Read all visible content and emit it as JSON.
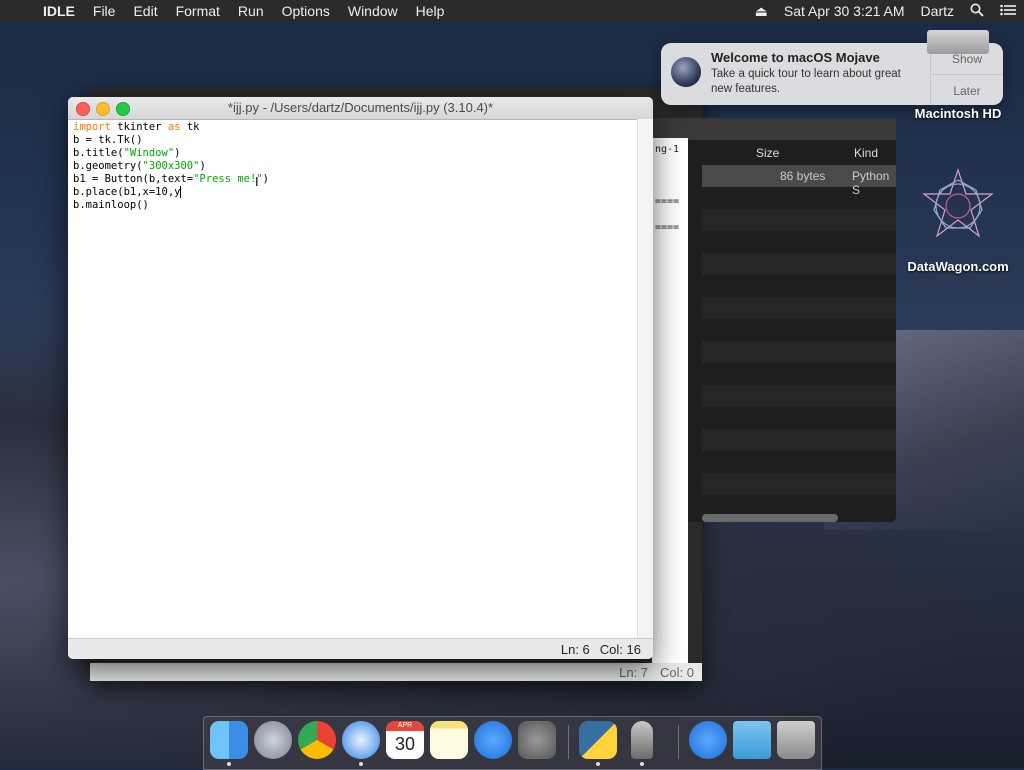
{
  "menubar": {
    "app_name": "IDLE",
    "items": [
      "File",
      "Edit",
      "Format",
      "Run",
      "Options",
      "Window",
      "Help"
    ],
    "datetime": "Sat Apr 30  3:21 AM",
    "user": "Dartz"
  },
  "back_window": {
    "status_ln": "Ln: 7",
    "status_col": "Col: 0",
    "shell_fragments": [
      "ng-1",
      "====",
      "===="
    ]
  },
  "finder": {
    "col_size": "Size",
    "col_kind": "Kind",
    "row_size": "86 bytes",
    "row_kind": "Python S"
  },
  "idle": {
    "title": "*ijj.py - /Users/dartz/Documents/ijj.py (3.10.4)*",
    "status_ln": "Ln: 6",
    "status_col": "Col: 16",
    "code": {
      "l1_kw1": "import",
      "l1_mid": " tkinter ",
      "l1_kw2": "as",
      "l1_end": " tk",
      "l2": "b = tk.Tk()",
      "l3_a": "b.title(",
      "l3_s": "\"Window\"",
      "l3_b": ")",
      "l4_a": "b.geometry(",
      "l4_s": "\"300x300\"",
      "l4_b": ")",
      "l5_a": "b1 = Button(b,text=",
      "l5_s": "\"Press me!\"",
      "l5_b": ")",
      "l6": "b.place(b1,x=10,y",
      "l7": "b.mainloop()"
    }
  },
  "notification": {
    "title": "Welcome to macOS Mojave",
    "body": "Take a quick tour to learn about great new features.",
    "show_label": "Show",
    "later_label": "Later"
  },
  "desktop": {
    "hd_label": "Macintosh HD",
    "datawagon_label": "DataWagon.com"
  },
  "dock": {
    "calendar_month": "APR",
    "calendar_day": "30"
  }
}
